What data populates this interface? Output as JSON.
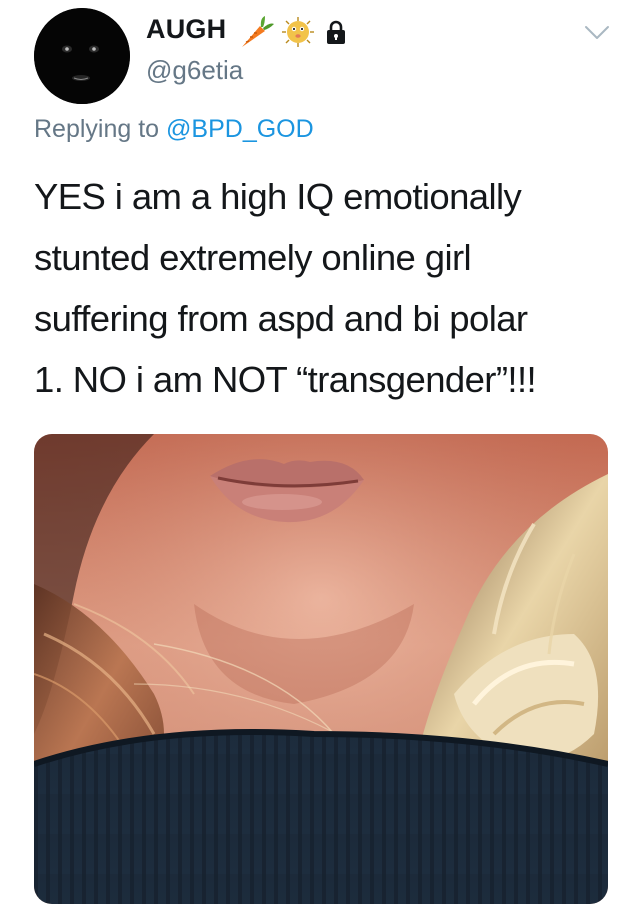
{
  "user": {
    "display_name": "AUGH",
    "name_emojis": [
      "carrot-icon",
      "blowfish-icon",
      "lock-icon"
    ],
    "handle": "@g6etia",
    "avatar": "black-balaclava-avatar"
  },
  "reply": {
    "prefix": "Replying to ",
    "mention": "@BPD_GOD"
  },
  "tweet": {
    "lines": [
      "YES i am a high IQ emotionally",
      "stunted extremely online girl",
      "suffering from aspd and bi polar",
      "1. NO i am NOT “transgender”!!!"
    ]
  },
  "media": {
    "subject": "close-up photo of lips, chin, blonde hair and dark ribbed sweater"
  },
  "colors": {
    "secondary_text": "#657786",
    "mention_blue": "#1b95e0",
    "primary_text": "#14171a"
  }
}
